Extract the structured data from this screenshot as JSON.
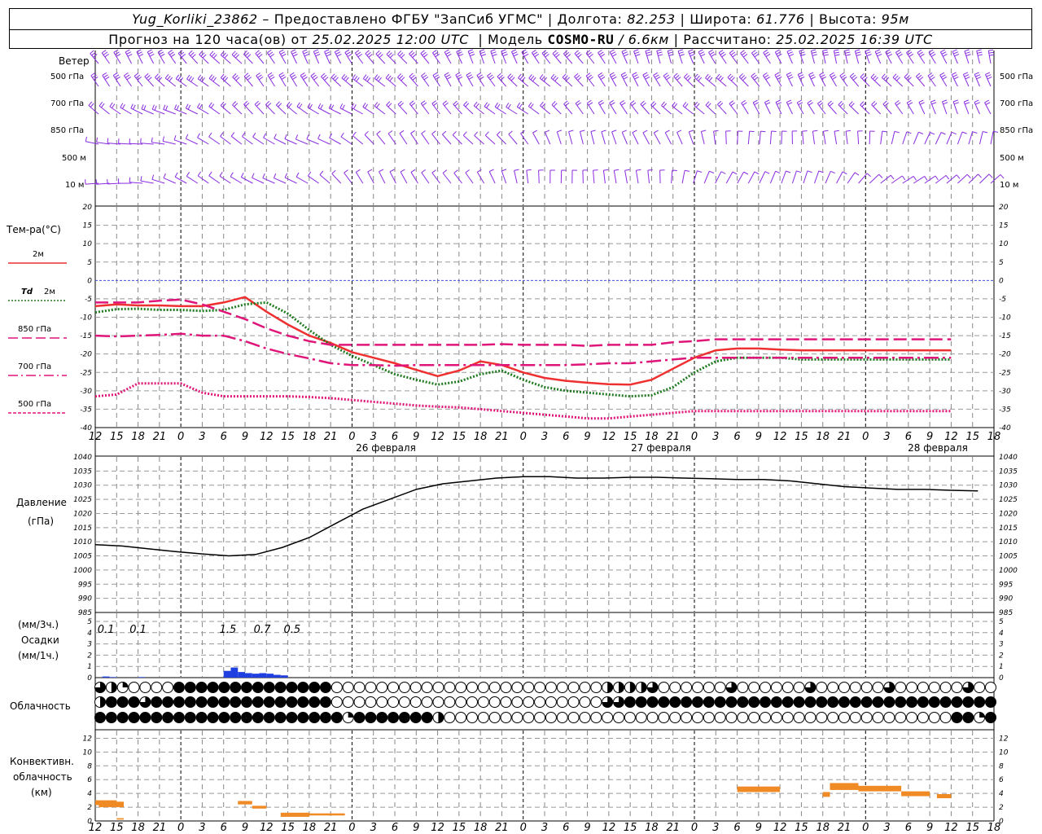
{
  "header": {
    "station": "Yug_Korliki_23862",
    "provider": "– Предоставлено ФГБУ \"ЗапСиб УГМС\"",
    "lon_label": "Долгота:",
    "lon_value": "82.253",
    "lat_label": "Широта:",
    "lat_value": "61.776",
    "alt_label": "Высота:",
    "alt_value": "95м",
    "forecast_prefix": "Прогноз на 120 часа(ов) от",
    "forecast_start": "25.02.2025 12:00 UTC",
    "model_label": "Модель",
    "model_name": "COSMO-RU",
    "model_res": "/ 6.6км",
    "calc_label": "Рассчитано:",
    "calc_time": "25.02.2025 16:39 UTC"
  },
  "labels": {
    "wind": "Ветер",
    "levels": [
      "500 гПа",
      "700 гПа",
      "850 гПа",
      "500 м",
      "10 м"
    ],
    "temp_title": "Тем-ра(°С)",
    "legend_2m": "2м",
    "legend_td_a": "Td",
    "legend_td_b": "2м",
    "legend_850": "850 гПа",
    "legend_700": "700 гПа",
    "legend_500": "500 гПа",
    "pressure_a": "Давление",
    "pressure_b": "(гПа)",
    "precip_a": "(мм/3ч.)",
    "precip_b": "Осадки",
    "precip_c": "(мм/1ч.)",
    "cloud": "Облачность",
    "conv_a": "Конвективн.",
    "conv_b": "облачность",
    "conv_c": "(км)"
  },
  "chart_data": [
    {
      "type": "line",
      "panel": "temperature",
      "x_hours": [
        0,
        3,
        6,
        9,
        12,
        15,
        18,
        21,
        24,
        27,
        30,
        33,
        36,
        39,
        42,
        45,
        48,
        51,
        54,
        57,
        60,
        63,
        66,
        69,
        72,
        75,
        78,
        81,
        84,
        87,
        90,
        93,
        96,
        99,
        102,
        105,
        108,
        111,
        114,
        117,
        120
      ],
      "x_tick_labels": [
        "12",
        "15",
        "18",
        "21",
        "0",
        "3",
        "6",
        "9",
        "12",
        "15",
        "18",
        "21",
        "0",
        "3",
        "6",
        "9",
        "12",
        "15",
        "18",
        "21",
        "0",
        "3",
        "6",
        "9",
        "12",
        "15",
        "18",
        "21",
        "0",
        "3",
        "6",
        "9",
        "12",
        "15",
        "18",
        "21",
        "0",
        "3",
        "6",
        "9",
        "12",
        "15",
        "18"
      ],
      "date_labels": [
        "26 февраля",
        "27 февраля",
        "28 февраля"
      ],
      "ylim": [
        -40,
        20
      ],
      "y_ticks": [
        -40,
        -35,
        -30,
        -25,
        -20,
        -15,
        -10,
        -5,
        0,
        5,
        10,
        15,
        20
      ],
      "series": [
        {
          "name": "2м",
          "color": "#ee3030",
          "dash": "solid",
          "values": [
            -7,
            -6.5,
            -6.8,
            -6.8,
            -7,
            -7,
            -6,
            -4.5,
            -8.5,
            -12,
            -15,
            -17,
            -19.5,
            -21,
            -22.5,
            -24.3,
            -26,
            -24.5,
            -22,
            -23,
            -25,
            -26.5,
            -27.3,
            -27.8,
            -28.2,
            -28.3,
            -27,
            -24,
            -21,
            -19,
            -18.5,
            -18.5,
            -18.8,
            -19,
            -19,
            -19,
            -19,
            -19,
            -19,
            -19,
            -19
          ]
        },
        {
          "name": "Td 2м",
          "color": "#207a20",
          "dash": "dotted",
          "values": [
            -8.7,
            -7.8,
            -7.7,
            -8,
            -8,
            -8.3,
            -8,
            -6.5,
            -6,
            -9,
            -13.5,
            -17.5,
            -20.5,
            -23,
            -25.5,
            -27,
            -28.3,
            -27.5,
            -25.5,
            -24.5,
            -27,
            -29,
            -30,
            -30.5,
            -31,
            -31.5,
            -31.2,
            -29,
            -25,
            -22,
            -21,
            -21,
            -21,
            -21.5,
            -21.5,
            -21.5,
            -21.5,
            -21.5,
            -21.5,
            -21.5,
            -21.5
          ]
        },
        {
          "name": "850 гПа",
          "color": "#e0157a",
          "dash": "longdash",
          "values": [
            -6,
            -6,
            -6,
            -5.5,
            -5.2,
            -6.5,
            -8.5,
            -10.5,
            -13,
            -15,
            -16.5,
            -17.5,
            -17.5,
            -17.5,
            -17.5,
            -17.5,
            -17.5,
            -17.5,
            -17.5,
            -17.3,
            -17.5,
            -17.5,
            -17.5,
            -17.8,
            -17.5,
            -17.5,
            -17.5,
            -16.8,
            -16.5,
            -16,
            -16,
            -16,
            -16,
            -16,
            -16,
            -16,
            -16,
            -16,
            -16,
            -16,
            -16
          ]
        },
        {
          "name": "700 гПа",
          "color": "#e0157a",
          "dash": "dashdot",
          "values": [
            -15,
            -15.2,
            -15,
            -14.8,
            -14.5,
            -15,
            -15,
            -16.5,
            -18.5,
            -20,
            -21.2,
            -22.5,
            -23,
            -23,
            -23.2,
            -23,
            -23,
            -23,
            -23,
            -23,
            -23,
            -23,
            -23,
            -22.8,
            -22.5,
            -22.5,
            -22,
            -21.5,
            -21,
            -21,
            -21,
            -21,
            -21,
            -21,
            -21,
            -21,
            -21,
            -21,
            -21,
            -21,
            -21
          ]
        },
        {
          "name": "500 гПа",
          "color": "#e0157a",
          "dash": "dotted",
          "values": [
            -31.5,
            -31,
            -28,
            -28,
            -28,
            -30.5,
            -31.5,
            -31.5,
            -31.5,
            -31.5,
            -31.7,
            -32,
            -32.5,
            -33,
            -33.5,
            -34,
            -34.3,
            -34.5,
            -35,
            -35.5,
            -36,
            -36.5,
            -37,
            -37.5,
            -37.5,
            -37,
            -36.5,
            -36,
            -35.5,
            -35.5,
            -35.5,
            -35.5,
            -35.5,
            -35.5,
            -35.5,
            -35.5,
            -35.5,
            -35.5,
            -35.5,
            -35.5,
            -35.5
          ]
        }
      ]
    },
    {
      "type": "line",
      "panel": "pressure",
      "ylim": [
        985,
        1040
      ],
      "y_ticks": [
        985,
        990,
        995,
        1000,
        1005,
        1010,
        1015,
        1020,
        1025,
        1030,
        1035,
        1040
      ],
      "series": [
        {
          "name": "Давление",
          "color": "#000000",
          "values": [
            1009,
            1008.5,
            1007.5,
            1006.5,
            1005.7,
            1005,
            1005.5,
            1008,
            1011.5,
            1016.5,
            1021.5,
            1025,
            1028.5,
            1030.5,
            1031.5,
            1032.5,
            1033,
            1033,
            1032.5,
            1032.5,
            1032.8,
            1032.8,
            1032.5,
            1032.3,
            1032,
            1032,
            1031.5,
            1030.5,
            1029.5,
            1029,
            1028.5,
            1028.5,
            1028.2,
            1028
          ]
        }
      ]
    },
    {
      "type": "bar",
      "panel": "precipitation",
      "ylim": [
        0,
        5
      ],
      "y_ticks": [
        0,
        1,
        2,
        3,
        4,
        5
      ],
      "data_labels": [
        {
          "x": 0.5,
          "text": "0.1"
        },
        {
          "x": 2,
          "text": "0.1"
        },
        {
          "x": 6.2,
          "text": "1.5"
        },
        {
          "x": 7.8,
          "text": "0.7"
        },
        {
          "x": 9.2,
          "text": "0.5"
        }
      ],
      "bars_hourly": [
        {
          "h": 1,
          "v": 0.1
        },
        {
          "h": 2,
          "v": 0.05
        },
        {
          "h": 6,
          "v": 0.05
        },
        {
          "h": 18,
          "v": 0.6
        },
        {
          "h": 19,
          "v": 0.9
        },
        {
          "h": 20,
          "v": 0.5
        },
        {
          "h": 21,
          "v": 0.4
        },
        {
          "h": 22,
          "v": 0.35
        },
        {
          "h": 23,
          "v": 0.4
        },
        {
          "h": 24,
          "v": 0.35
        },
        {
          "h": 25,
          "v": 0.25
        },
        {
          "h": 26,
          "v": 0.2
        }
      ]
    },
    {
      "type": "bar",
      "panel": "convective_cloud",
      "ylim": [
        0,
        14
      ],
      "y_ticks": [
        0,
        2,
        4,
        6,
        8,
        10,
        12
      ],
      "segments": [
        {
          "x0": 0,
          "x1": 3,
          "base": 2.3,
          "top": 3.0
        },
        {
          "x0": 0.5,
          "x1": 4,
          "base": 2.0,
          "top": 2.8
        },
        {
          "x0": 3,
          "x1": 4,
          "base": 0.2,
          "top": 0.4
        },
        {
          "x0": 20,
          "x1": 22,
          "base": 2.4,
          "top": 2.9
        },
        {
          "x0": 22,
          "x1": 24,
          "base": 1.8,
          "top": 2.2
        },
        {
          "x0": 26,
          "x1": 30,
          "base": 0.6,
          "top": 1.2
        },
        {
          "x0": 30,
          "x1": 35,
          "base": 0.8,
          "top": 1.1
        },
        {
          "x0": 90,
          "x1": 96,
          "base": 4.2,
          "top": 5.0
        },
        {
          "x0": 102,
          "x1": 103,
          "base": 3.5,
          "top": 4.2
        },
        {
          "x0": 103,
          "x1": 107,
          "base": 4.5,
          "top": 5.5
        },
        {
          "x0": 107,
          "x1": 113,
          "base": 4.3,
          "top": 5.1
        },
        {
          "x0": 113,
          "x1": 117,
          "base": 3.6,
          "top": 4.3
        },
        {
          "x0": 118,
          "x1": 120,
          "base": 3.3,
          "top": 3.9
        }
      ]
    }
  ]
}
